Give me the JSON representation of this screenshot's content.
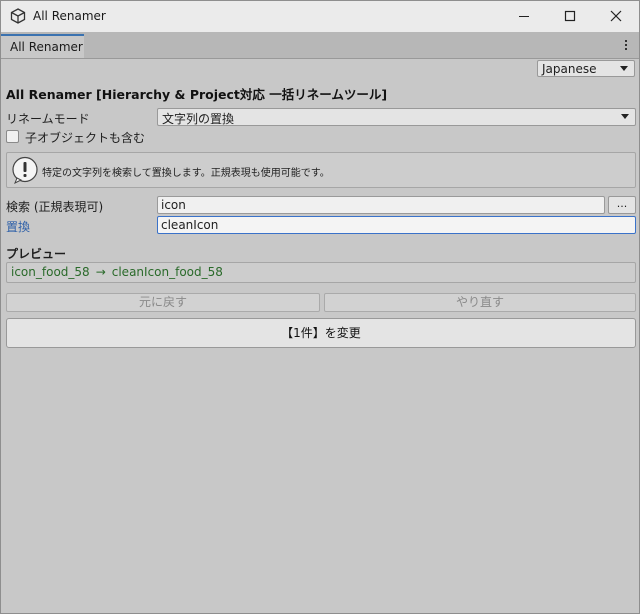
{
  "window": {
    "title": "All Renamer",
    "tab_label": "All Renamer"
  },
  "language": {
    "selected": "Japanese"
  },
  "header": {
    "title": "All Renamer [Hierarchy & Project対応 一括リネームツール]"
  },
  "rename_mode": {
    "label": "リネームモード",
    "selected": "文字列の置換"
  },
  "include_children": {
    "label": "子オブジェクトも含む",
    "checked": false
  },
  "help": {
    "text": "特定の文字列を検索して置換します。正規表現も使用可能です。"
  },
  "search": {
    "label": "検索 (正規表現可)",
    "value": "icon",
    "browse_label": "..."
  },
  "replace": {
    "label": "置換",
    "value": "cleanIcon"
  },
  "preview": {
    "title": "プレビュー",
    "before": "icon_food_58",
    "arrow": "→",
    "after": "cleanIcon_food_58"
  },
  "actions": {
    "undo_label": "元に戻す",
    "redo_label": "やり直す",
    "apply_label": "【1件】を変更"
  },
  "colors": {
    "background": "#c8c8c8",
    "titlebar": "#ebebeb",
    "accent": "#3a72b0",
    "preview_text": "#2a6a2a"
  }
}
